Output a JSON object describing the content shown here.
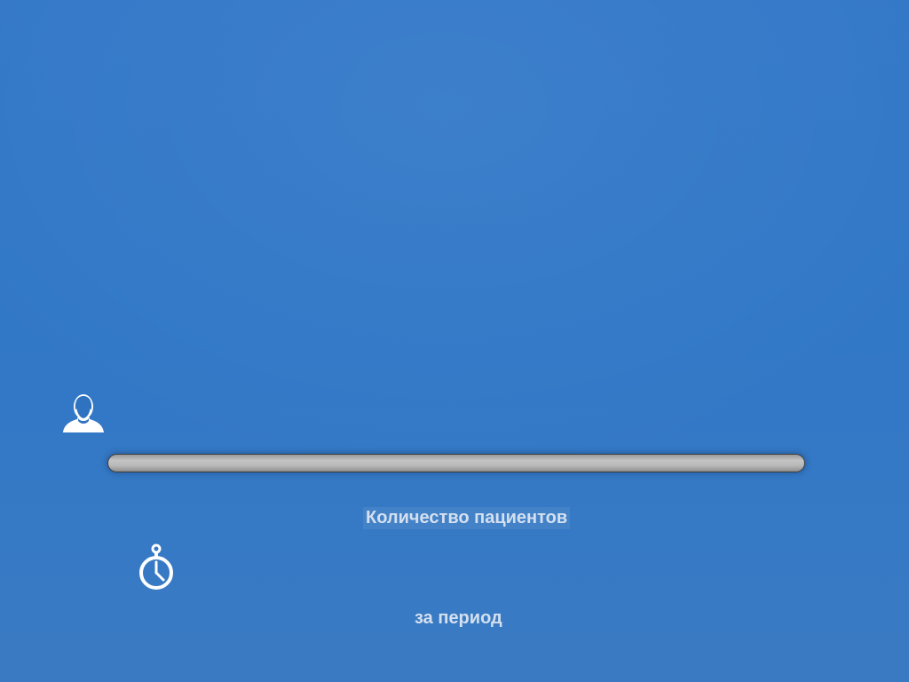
{
  "icons": {
    "person": "person-silhouette-icon",
    "timer": "stopwatch-icon"
  },
  "progress": {
    "fill_fraction": 0
  },
  "labels": {
    "patients": "Количество пациентов",
    "period": "за период"
  },
  "colors": {
    "background": "#3178c7",
    "label_text": "#d4e0ef",
    "track": "#b8b8b8"
  }
}
